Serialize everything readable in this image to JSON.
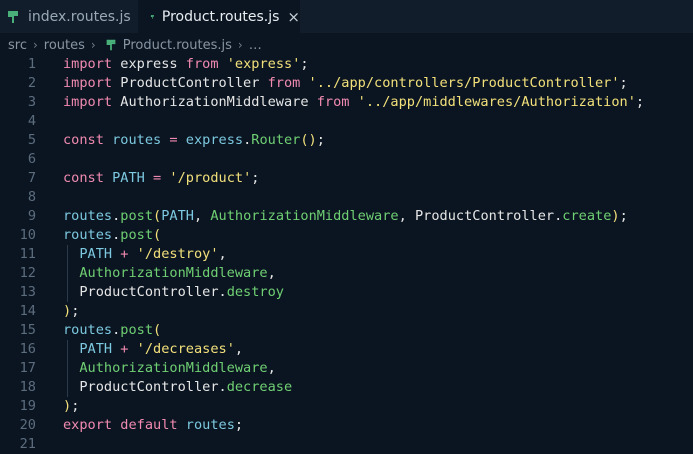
{
  "tabs": [
    {
      "label": "index.routes.js",
      "icon": "route-file-icon",
      "active": false
    },
    {
      "label": "Product.routes.js",
      "icon": "route-file-icon",
      "active": true,
      "close": "×"
    }
  ],
  "breadcrumb": {
    "items": [
      "src",
      "routes"
    ],
    "file": "Product.routes.js",
    "ellipsis": "…",
    "separator": "›"
  },
  "editor": {
    "lines": [
      [
        {
          "t": "import",
          "c": "kw"
        },
        {
          "t": " express ",
          "c": "punc"
        },
        {
          "t": "from",
          "c": "kw"
        },
        {
          "t": " ",
          "c": "punc"
        },
        {
          "t": "'express'",
          "c": "str"
        },
        {
          "t": ";",
          "c": "punc"
        }
      ],
      [
        {
          "t": "import",
          "c": "kw"
        },
        {
          "t": " ProductController ",
          "c": "punc"
        },
        {
          "t": "from",
          "c": "kw"
        },
        {
          "t": " ",
          "c": "punc"
        },
        {
          "t": "'../app/controllers/ProductController'",
          "c": "str"
        },
        {
          "t": ";",
          "c": "punc"
        }
      ],
      [
        {
          "t": "import",
          "c": "kw"
        },
        {
          "t": " AuthorizationMiddleware ",
          "c": "punc"
        },
        {
          "t": "from",
          "c": "kw"
        },
        {
          "t": " ",
          "c": "punc"
        },
        {
          "t": "'../app/middlewares/Authorization'",
          "c": "str"
        },
        {
          "t": ";",
          "c": "punc"
        }
      ],
      [],
      [
        {
          "t": "const",
          "c": "kw"
        },
        {
          "t": " routes ",
          "c": "cls"
        },
        {
          "t": "= ",
          "c": "kw"
        },
        {
          "t": "express",
          "c": "cls"
        },
        {
          "t": ".",
          "c": "punc"
        },
        {
          "t": "Router",
          "c": "fn"
        },
        {
          "t": "()",
          "c": "str"
        },
        {
          "t": ";",
          "c": "punc"
        }
      ],
      [],
      [
        {
          "t": "const",
          "c": "kw"
        },
        {
          "t": " PATH ",
          "c": "cls"
        },
        {
          "t": "= ",
          "c": "kw"
        },
        {
          "t": "'/product'",
          "c": "str"
        },
        {
          "t": ";",
          "c": "punc"
        }
      ],
      [],
      [
        {
          "t": "routes",
          "c": "cls"
        },
        {
          "t": ".",
          "c": "punc"
        },
        {
          "t": "post",
          "c": "fn"
        },
        {
          "t": "(",
          "c": "str"
        },
        {
          "t": "PATH",
          "c": "cls"
        },
        {
          "t": ", ",
          "c": "punc"
        },
        {
          "t": "AuthorizationMiddleware",
          "c": "fn"
        },
        {
          "t": ", ProductController.",
          "c": "punc"
        },
        {
          "t": "create",
          "c": "fn"
        },
        {
          "t": ")",
          "c": "str"
        },
        {
          "t": ";",
          "c": "punc"
        }
      ],
      [
        {
          "t": "routes",
          "c": "cls"
        },
        {
          "t": ".",
          "c": "punc"
        },
        {
          "t": "post",
          "c": "fn"
        },
        {
          "t": "(",
          "c": "str"
        }
      ],
      [
        {
          "t": "  PATH ",
          "c": "cls"
        },
        {
          "t": "+ ",
          "c": "kw"
        },
        {
          "t": "'/destroy'",
          "c": "str"
        },
        {
          "t": ",",
          "c": "punc"
        }
      ],
      [
        {
          "t": "  AuthorizationMiddleware",
          "c": "fn"
        },
        {
          "t": ",",
          "c": "punc"
        }
      ],
      [
        {
          "t": "  ProductController.",
          "c": "punc"
        },
        {
          "t": "destroy",
          "c": "fn"
        }
      ],
      [
        {
          "t": ")",
          "c": "str"
        },
        {
          "t": ";",
          "c": "punc"
        }
      ],
      [
        {
          "t": "routes",
          "c": "cls"
        },
        {
          "t": ".",
          "c": "punc"
        },
        {
          "t": "post",
          "c": "fn"
        },
        {
          "t": "(",
          "c": "str"
        }
      ],
      [
        {
          "t": "  PATH ",
          "c": "cls"
        },
        {
          "t": "+ ",
          "c": "kw"
        },
        {
          "t": "'/decreases'",
          "c": "str"
        },
        {
          "t": ",",
          "c": "punc"
        }
      ],
      [
        {
          "t": "  AuthorizationMiddleware",
          "c": "fn"
        },
        {
          "t": ",",
          "c": "punc"
        }
      ],
      [
        {
          "t": "  ProductController.",
          "c": "punc"
        },
        {
          "t": "decrease",
          "c": "fn"
        }
      ],
      [
        {
          "t": ")",
          "c": "str"
        },
        {
          "t": ";",
          "c": "punc"
        }
      ],
      [
        {
          "t": "export",
          "c": "kw"
        },
        {
          "t": " ",
          "c": "punc"
        },
        {
          "t": "default",
          "c": "kw"
        },
        {
          "t": " routes",
          "c": "cls"
        },
        {
          "t": ";",
          "c": "punc"
        }
      ],
      []
    ],
    "guides": [
      11,
      12,
      13,
      16,
      17,
      18
    ]
  },
  "colors": {
    "keyword": "#f08ab0",
    "string": "#f2e07b",
    "function": "#6fcf73",
    "identifier": "#7cc9e0",
    "background": "#0b1521"
  }
}
